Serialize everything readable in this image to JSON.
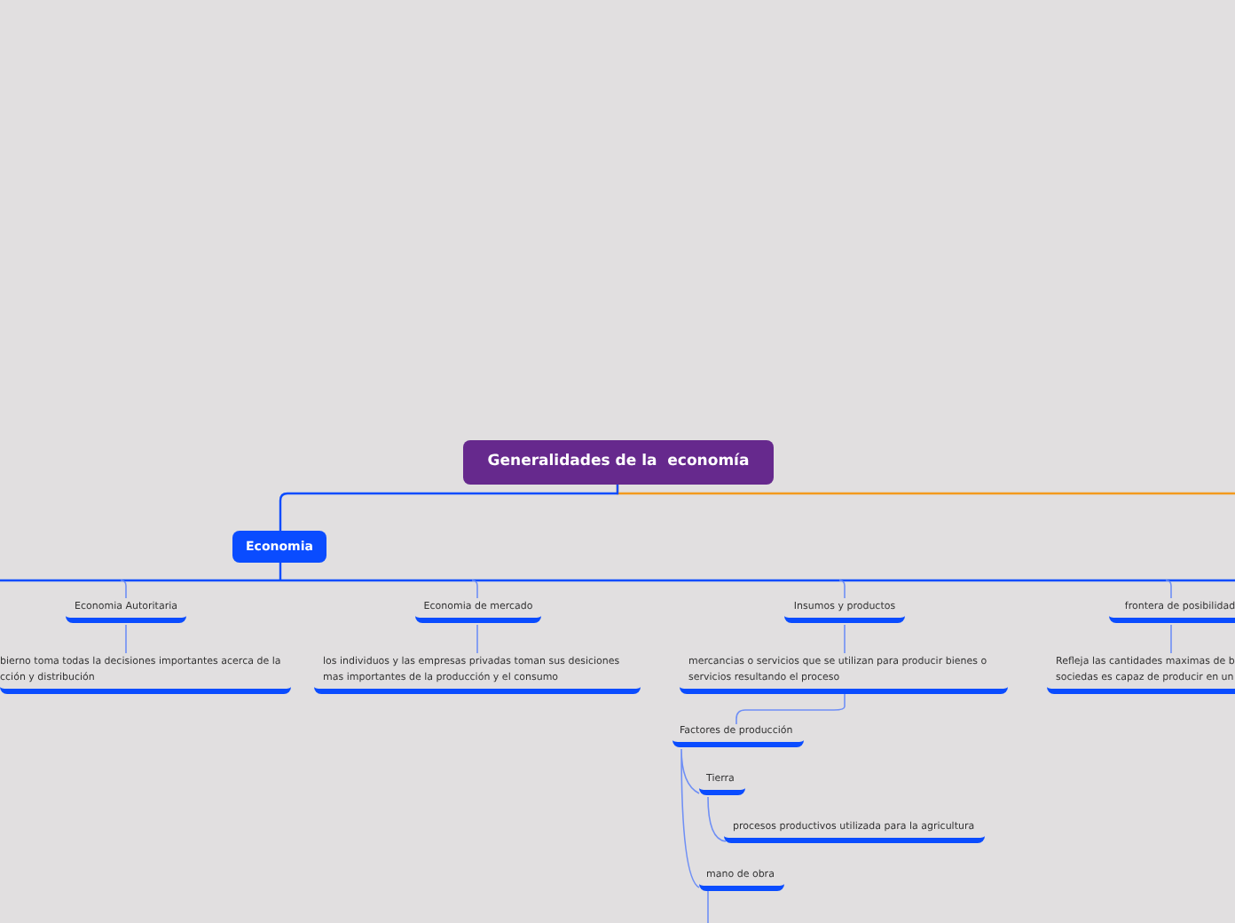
{
  "root": {
    "title": "Generalidades de la  economía"
  },
  "main_topic": {
    "label": "Economia"
  },
  "subtopics": [
    {
      "title": "Economia Autoritaria",
      "description": [
        "bierno toma todas la decisiones importantes acerca de la",
        "cción y distribución"
      ]
    },
    {
      "title": "Economia de mercado",
      "description": [
        "los individuos y las empresas privadas toman sus desiciones",
        "mas importantes de la producción y el consumo"
      ]
    },
    {
      "title": "Insumos y productos",
      "description": [
        "mercancias o servicios que se utilizan para producir bienes o",
        "servicios resultando el proceso"
      ]
    },
    {
      "title": "frontera de posibilidad",
      "description": [
        "Refleja las cantidades maximas de b",
        "sociedas es capaz de producir en un"
      ]
    }
  ],
  "factores": {
    "title": "Factores de producción",
    "children": [
      {
        "title": "Tierra",
        "description": "procesos productivos utilizada para la agricultura"
      },
      {
        "title": "mano de obra"
      }
    ]
  }
}
